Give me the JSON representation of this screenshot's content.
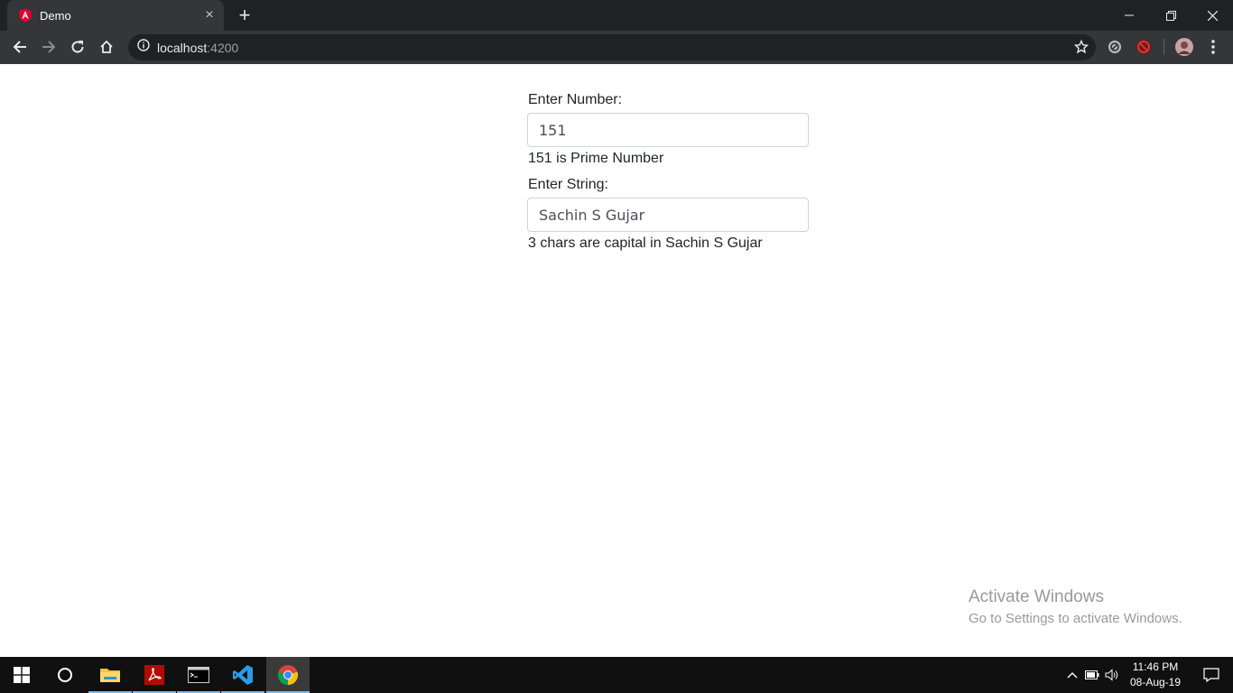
{
  "browser": {
    "tab_title": "Demo",
    "tab_close": "×",
    "new_tab": "+",
    "url_host": "localhost",
    "url_port": ":4200"
  },
  "form": {
    "number_label": "Enter Number:",
    "number_value": "151",
    "number_result": "151 is Prime Number",
    "string_label": "Enter String:",
    "string_value": "Sachin S Gujar",
    "string_result": "3 chars are capital in Sachin S Gujar"
  },
  "watermark": {
    "title": "Activate Windows",
    "subtitle": "Go to Settings to activate Windows."
  },
  "taskbar": {
    "time": "11:46 PM",
    "date": "08-Aug-19"
  },
  "colors": {
    "angular_red": "#dd0031",
    "chrome_dark": "#202124",
    "toolbar": "#35363a"
  }
}
